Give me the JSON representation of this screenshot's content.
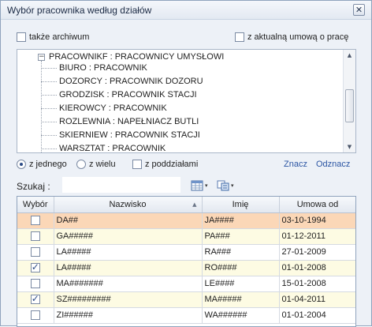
{
  "window": {
    "title": "Wybór pracownika według działów",
    "close_glyph": "✕"
  },
  "options": {
    "archive_label": "także archiwum",
    "archive_checked": false,
    "contract_label": "z aktualną umową o pracę",
    "contract_checked": false
  },
  "tree": {
    "root_expander": "−",
    "root_label": "PRACOWNIKF : PRACOWNICY UMYSŁOWI",
    "children": [
      "BIURO : PRACOWNIK",
      "DOZORCY : PRACOWNIK DOZORU",
      "GRODZISK : PRACOWNIK STACJI",
      "KIEROWCY : PRACOWNIK",
      "ROZLEWNIA : NAPEŁNIACZ BUTLI",
      "SKIERNIEW : PRACOWNIK STACJI",
      "WARSZTAT : PRACOWNIK"
    ],
    "scroll_up": "▲",
    "scroll_down": "▼"
  },
  "mode": {
    "single_label": "z jednego",
    "single_checked": true,
    "multi_label": "z wielu",
    "multi_checked": false,
    "sub_label": "z poddziałami",
    "sub_checked": false,
    "mark_link": "Znacz",
    "unmark_link": "Odznacz"
  },
  "search": {
    "label": "Szukaj  :",
    "value": "",
    "ddarrow": "▾"
  },
  "grid": {
    "columns": [
      "Wybór",
      "Nazwisko",
      "Imię",
      "Umowa od"
    ],
    "sort_glyph": "▲",
    "rows": [
      {
        "checked": false,
        "nazwisko": "DA##",
        "imie": "JA####",
        "umowa": "03-10-1994",
        "style": "selected"
      },
      {
        "checked": false,
        "nazwisko": "GA#####",
        "imie": "PA###",
        "umowa": "01-12-2011",
        "style": "alt"
      },
      {
        "checked": false,
        "nazwisko": "LA#####",
        "imie": "RA###",
        "umowa": "27-01-2009",
        "style": "norm"
      },
      {
        "checked": true,
        "nazwisko": "LA#####",
        "imie": "RO####",
        "umowa": "01-01-2008",
        "style": "alt"
      },
      {
        "checked": false,
        "nazwisko": "MA#######",
        "imie": "LE####",
        "umowa": "15-01-2008",
        "style": "norm"
      },
      {
        "checked": true,
        "nazwisko": "SZ#########",
        "imie": "MA#####",
        "umowa": "01-04-2011",
        "style": "alt"
      },
      {
        "checked": false,
        "nazwisko": "ZI######",
        "imie": "WA######",
        "umowa": "01-01-2004",
        "style": "norm"
      }
    ]
  },
  "colors": {
    "accent_link": "#2b55a3",
    "selected_row": "#fbd7b7",
    "alt_row": "#fdfbe3",
    "window_bg": "#edf1f7"
  }
}
